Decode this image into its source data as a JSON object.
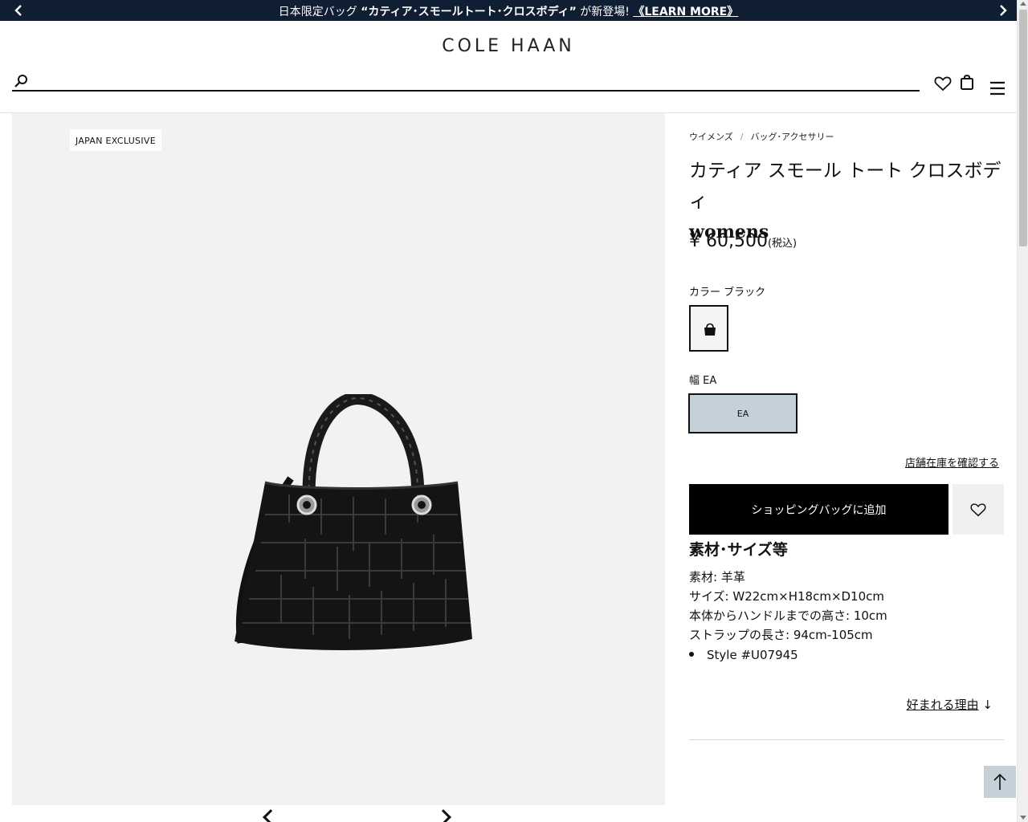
{
  "promo": {
    "prefix": "日本限定バッグ ",
    "highlight": "“カティア･スモールトート･クロスボディ”",
    "suffix": " が新登場! ",
    "link": "《LEARN MORE》"
  },
  "header": {
    "logo": "COLE HAAN",
    "search_placeholder": ""
  },
  "gallery": {
    "badge": "JAPAN EXCLUSIVE"
  },
  "breadcrumb": {
    "items": [
      "ウイメンズ",
      "バッグ･アクセサリー"
    ],
    "separator": "/"
  },
  "product": {
    "title": "カティア スモール トート クロスボディ",
    "subtitle": "womens",
    "price": "¥ 60,500",
    "tax_note": "(税込)",
    "color_label": "カラー",
    "color_value": "ブラック",
    "width_label": "幅",
    "width_value": "EA",
    "size_option": "EA",
    "store_stock_link": "店舗在庫を確認する",
    "add_to_bag": "ショッピングバッグに追加",
    "material_heading": "素材･サイズ等",
    "specs": [
      "素材: 羊革",
      "サイズ: W22cm×H18cm×D10cm",
      "本体からハンドルまでの高さ: 10cm",
      "ストラップの長さ: 94cm-105cm"
    ],
    "style": "Style #U07945",
    "reasons_link": "好まれる理由",
    "reasons_arrow": "↓"
  },
  "colors": {
    "promo_bg": "#0f1e33",
    "size_selected_bg": "#c5d1d9",
    "gallery_bg": "#f2f2f2"
  }
}
